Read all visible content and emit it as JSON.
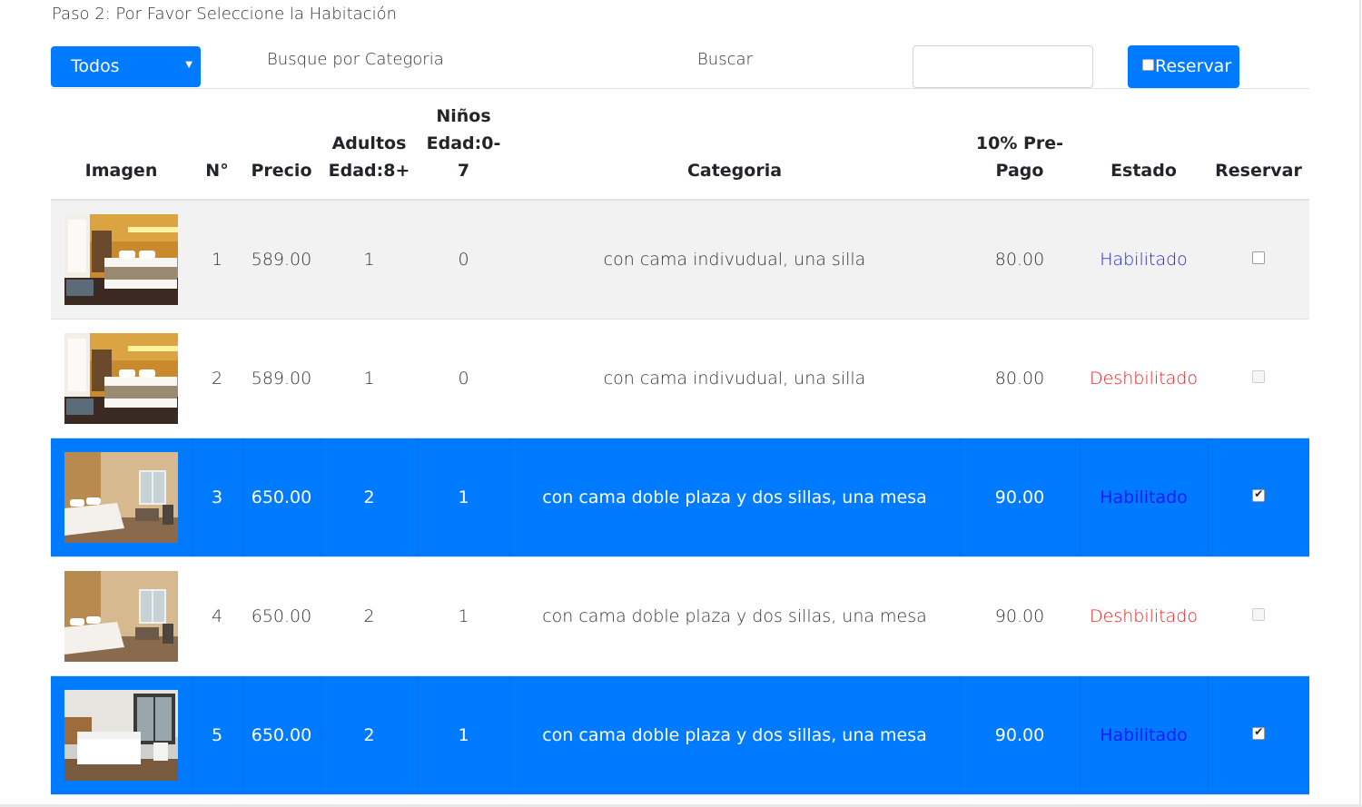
{
  "step_title": "Paso 2: Por Favor Seleccione la Habitación",
  "toolbar": {
    "category_select": "Todos",
    "category_label": "Busque por Categoria",
    "search_label": "Buscar",
    "search_value": "",
    "reserve_button": "Reservar"
  },
  "table": {
    "headers": {
      "image": "Imagen",
      "number": "N°",
      "price": "Precio",
      "adults": [
        "Adultos",
        "Edad:8+"
      ],
      "children": [
        "Niños",
        "Edad:0-",
        "7"
      ],
      "category": "Categoria",
      "prepay": [
        "10% Pre-",
        "Pago"
      ],
      "status": "Estado",
      "reserve": "Reservar"
    },
    "rows": [
      {
        "number": "1",
        "price": "589.00",
        "adults": "1",
        "children": "0",
        "category": "con cama indivudual, una silla",
        "prepay": "80.00",
        "status": "Habilitado",
        "enabled": true,
        "checked": false,
        "selected": false,
        "room": "single"
      },
      {
        "number": "2",
        "price": "589.00",
        "adults": "1",
        "children": "0",
        "category": "con cama indivudual, una silla",
        "prepay": "80.00",
        "status": "Deshbilitado",
        "enabled": false,
        "checked": false,
        "selected": false,
        "room": "single"
      },
      {
        "number": "3",
        "price": "650.00",
        "adults": "2",
        "children": "1",
        "category": "con cama doble plaza y dos sillas, una mesa",
        "prepay": "90.00",
        "status": "Habilitado",
        "enabled": true,
        "checked": true,
        "selected": true,
        "room": "double"
      },
      {
        "number": "4",
        "price": "650.00",
        "adults": "2",
        "children": "1",
        "category": "con cama doble plaza y dos sillas, una mesa",
        "prepay": "90.00",
        "status": "Deshbilitado",
        "enabled": false,
        "checked": false,
        "selected": false,
        "room": "double"
      },
      {
        "number": "5",
        "price": "650.00",
        "adults": "2",
        "children": "1",
        "category": "con cama doble plaza y dos sillas, una mesa",
        "prepay": "90.00",
        "status": "Habilitado",
        "enabled": true,
        "checked": true,
        "selected": true,
        "room": "white"
      }
    ]
  },
  "colors": {
    "primary": "#007bff",
    "enabled_status": "#2222dd",
    "disabled_status": "#ee1c1c",
    "stripe": "#f2f2f2"
  }
}
